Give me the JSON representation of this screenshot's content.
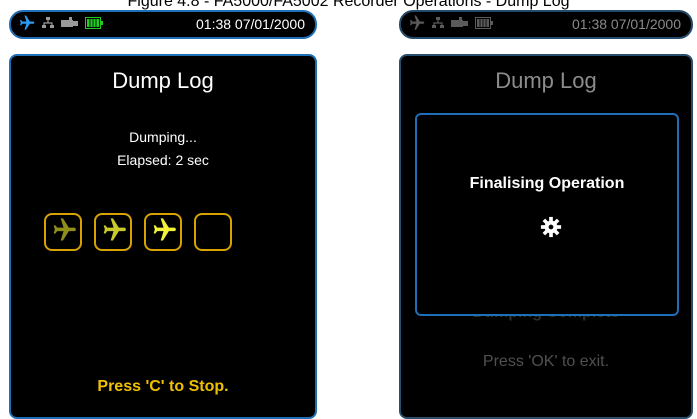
{
  "caption": "Figure 4.8 - FA5000/FA5002 Recorder Operations - Dump Log",
  "colors": {
    "accent_blue": "#1e6fb5",
    "progress_yellow": "#d8a300",
    "stop_text": "#f0c000",
    "battery_green": "#22cc22"
  },
  "left": {
    "statusbar": {
      "icons": [
        "airplane-icon",
        "network-icon",
        "usb-icon",
        "battery-icon"
      ],
      "clock": "01:38 07/01/2000"
    },
    "title": "Dump Log",
    "status": {
      "line1": "Dumping...",
      "line2": "Elapsed: 2 sec"
    },
    "progress": {
      "boxes": [
        {
          "state": "done",
          "icon": "airplane-icon"
        },
        {
          "state": "done",
          "icon": "airplane-icon"
        },
        {
          "state": "active",
          "icon": "airplane-icon"
        },
        {
          "state": "empty",
          "icon": ""
        }
      ]
    },
    "stop_prompt": "Press 'C' to Stop."
  },
  "right": {
    "statusbar": {
      "icons": [
        "airplane-icon",
        "network-icon",
        "usb-icon",
        "battery-icon"
      ],
      "clock": "01:38 07/01/2000"
    },
    "title": "Dump Log",
    "behind_status": "Dumping Complete",
    "exit_prompt": "Press 'OK' to exit.",
    "dialog": {
      "message": "Finalising Operation",
      "icon": "gear-icon"
    }
  }
}
